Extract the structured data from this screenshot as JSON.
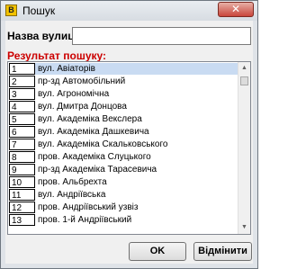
{
  "window": {
    "title": "Пошук",
    "app_icon": "В",
    "close_glyph": "✕"
  },
  "search": {
    "label": "Назва вулиці:",
    "value": ""
  },
  "results": {
    "label": "Результат пошуку:",
    "rows": [
      {
        "num": "1",
        "name": "вул. Авіаторів"
      },
      {
        "num": "2",
        "name": "пр-зд Автомобільний"
      },
      {
        "num": "3",
        "name": "вул. Агрономічна"
      },
      {
        "num": "4",
        "name": "вул. Дмитра Донцова"
      },
      {
        "num": "5",
        "name": "вул. Академіка Векслера"
      },
      {
        "num": "6",
        "name": "вул. Академіка Дашкевича"
      },
      {
        "num": "7",
        "name": "вул. Академіка Скальковського"
      },
      {
        "num": "8",
        "name": "пров. Академіка Слуцького"
      },
      {
        "num": "9",
        "name": "пр-зд Академіка Тарасевича"
      },
      {
        "num": "10",
        "name": "пров. Альбрехта"
      },
      {
        "num": "11",
        "name": "вул. Андріївська"
      },
      {
        "num": "12",
        "name": "пров. Андріївський узвіз"
      },
      {
        "num": "13",
        "name": "пров. 1-й Андріївський"
      }
    ]
  },
  "buttons": {
    "ok": "OK",
    "cancel": "Відмінити"
  },
  "colors": {
    "selection": "#c9dbf2",
    "results_label": "#cc0000"
  }
}
